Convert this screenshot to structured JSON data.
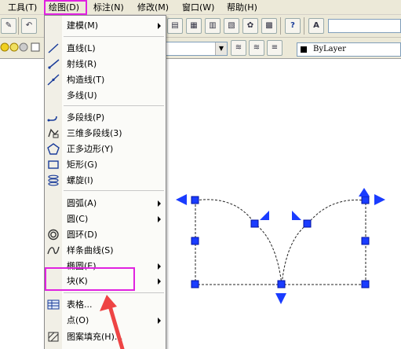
{
  "menubar": {
    "items": [
      {
        "label": "工具(T)"
      },
      {
        "label": "绘图(D)"
      },
      {
        "label": "标注(N)"
      },
      {
        "label": "修改(M)"
      },
      {
        "label": "窗口(W)"
      },
      {
        "label": "帮助(H)"
      }
    ]
  },
  "toolbar": {
    "lineweight_value": "ByLayer"
  },
  "draw_menu": {
    "items": [
      {
        "label": "建模(M)",
        "icon": "none",
        "submenu": true
      },
      {
        "label": "直线(L)",
        "icon": "line-icon",
        "submenu": false
      },
      {
        "label": "射线(R)",
        "icon": "ray-icon",
        "submenu": false
      },
      {
        "label": "构造线(T)",
        "icon": "construction-line-icon",
        "submenu": false
      },
      {
        "label": "多线(U)",
        "icon": "none",
        "submenu": false
      },
      {
        "label": "多段线(P)",
        "icon": "polyline-icon",
        "submenu": false
      },
      {
        "label": "三维多段线(3)",
        "icon": "3d-polyline-icon",
        "submenu": false
      },
      {
        "label": "正多边形(Y)",
        "icon": "polygon-icon",
        "submenu": false
      },
      {
        "label": "矩形(G)",
        "icon": "rectangle-icon",
        "submenu": false
      },
      {
        "label": "螺旋(I)",
        "icon": "helix-icon",
        "submenu": false
      },
      {
        "label": "圆弧(A)",
        "icon": "none",
        "submenu": true
      },
      {
        "label": "圆(C)",
        "icon": "none",
        "submenu": true
      },
      {
        "label": "圆环(D)",
        "icon": "donut-icon",
        "submenu": false
      },
      {
        "label": "样条曲线(S)",
        "icon": "spline-icon",
        "submenu": false
      },
      {
        "label": "椭圆(E)",
        "icon": "none",
        "submenu": true
      },
      {
        "label": "块(K)",
        "icon": "none",
        "submenu": true
      },
      {
        "label": "表格...",
        "icon": "table-icon",
        "submenu": false
      },
      {
        "label": "点(O)",
        "icon": "none",
        "submenu": true
      },
      {
        "label": "图案填充(H)...",
        "icon": "hatch-icon",
        "submenu": false
      }
    ]
  },
  "colors": {
    "highlight": "#e022e0",
    "grip": "#1a3cff",
    "arrow": "#ee4444"
  }
}
